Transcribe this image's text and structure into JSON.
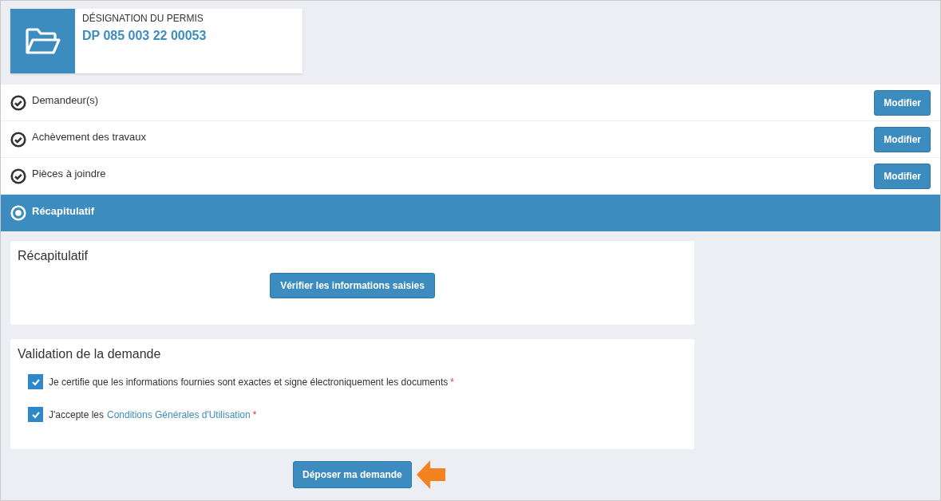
{
  "permit": {
    "label": "DÉSIGNATION DU PERMIS",
    "number": "DP 085 003 22 00053"
  },
  "steps": [
    {
      "label": "Demandeur(s)",
      "selected": false,
      "button": "Modifier"
    },
    {
      "label": "Achèvement des travaux",
      "selected": false,
      "button": "Modifier"
    },
    {
      "label": "Pièces à joindre",
      "selected": false,
      "button": "Modifier"
    },
    {
      "label": "Récapitulatif",
      "selected": true
    }
  ],
  "summary": {
    "title": "Récapitulatif",
    "button": "Vérifier les informations saisies"
  },
  "validation": {
    "title": "Validation de la demande",
    "items": [
      {
        "text": "Je certifie que les informations fournies sont exactes et signe électroniquement les documents",
        "checked": true,
        "required": "*"
      },
      {
        "text": "J'accepte les",
        "link": "Conditions Générales d'Utilisation",
        "checked": true,
        "required": "*"
      }
    ]
  },
  "submit": "Déposer ma demande"
}
